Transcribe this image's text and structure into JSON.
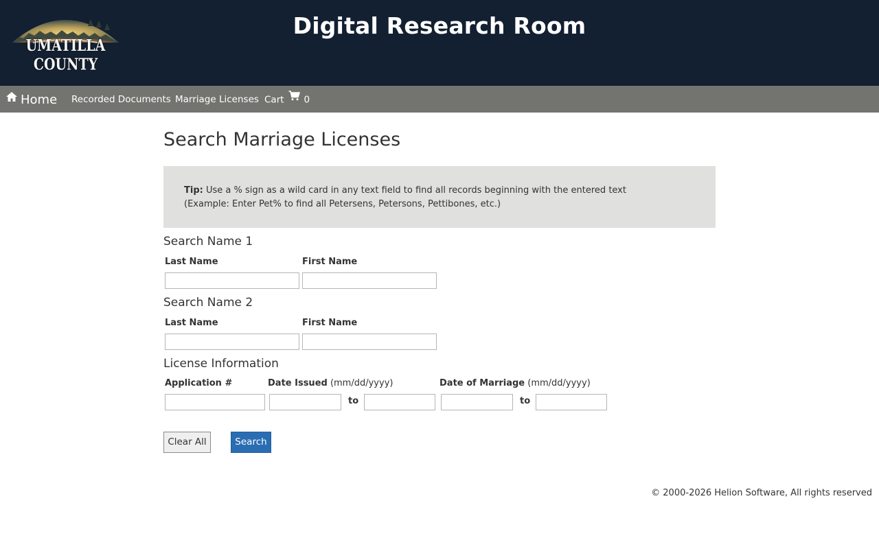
{
  "header": {
    "logo_text": "UMATILLA COUNTY",
    "title": "Digital Research Room"
  },
  "nav": {
    "home": "Home",
    "recorded_documents": "Recorded Documents",
    "marriage_licenses": "Marriage Licenses",
    "cart": "Cart",
    "cart_count": "0"
  },
  "page": {
    "title": "Search Marriage Licenses",
    "tip_label": "Tip:",
    "tip_line1": " Use a % sign as a wild card in any text field to find all records beginning with the entered text",
    "tip_line2": "(Example: Enter Pet% to find all Petersens, Petersons, Pettibones, etc.)"
  },
  "search_name_1": {
    "title": "Search Name 1",
    "last_name_label": "Last Name",
    "first_name_label": "First Name",
    "last_name_value": "",
    "first_name_value": ""
  },
  "search_name_2": {
    "title": "Search Name 2",
    "last_name_label": "Last Name",
    "first_name_label": "First Name",
    "last_name_value": "",
    "first_name_value": ""
  },
  "license_info": {
    "title": "License Information",
    "application_label": "Application #",
    "date_issued_label": "Date Issued",
    "date_issued_hint": " (mm/dd/yyyy)",
    "date_of_marriage_label": "Date of Marriage",
    "date_of_marriage_hint": " (mm/dd/yyyy)",
    "to_label": "to"
  },
  "buttons": {
    "clear_all": "Clear All",
    "search": "Search"
  },
  "footer": {
    "copyright": "© 2000-2026 Helion Software, All rights reserved"
  },
  "colors": {
    "header_bg": "#132032",
    "navbar_bg": "#73746f",
    "tip_bg": "#e0e0df",
    "search_button": "#2a6db3"
  }
}
